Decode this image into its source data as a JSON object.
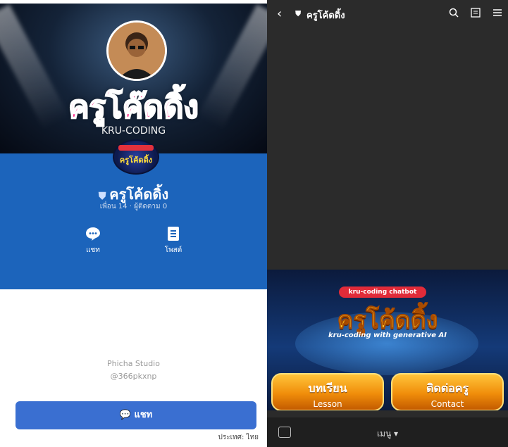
{
  "left": {
    "hero_title": "ครูโค๊ดดิ้ง",
    "hero_subtitle": "KRU-CODING",
    "logo_text": "ครูโค้ดดิ้ง",
    "account_name": "ครูโค้ดดิ้ง",
    "stats": "เพื่อน 14 · ผู้ติดตาม 0",
    "actions": [
      {
        "label": "แชท",
        "icon": "chat-icon"
      },
      {
        "label": "โพสต์",
        "icon": "post-icon"
      }
    ],
    "studio_name": "Phicha Studio",
    "studio_id": "@366pkxnp",
    "chat_button": "แชท",
    "language": "ประเทศ: ไทย"
  },
  "right": {
    "title": "ครูโค้ดดิ้ง",
    "banner": {
      "tag": "kru-coding chatbot",
      "title": "ครูโค้ดดิ้ง",
      "subtitle": "kru-coding with generative AI"
    },
    "buttons": [
      {
        "th": "บทเรียน",
        "en": "Lesson"
      },
      {
        "th": "ติดต่อครู",
        "en": "Contact"
      }
    ],
    "menu_label": "เมนู ▾"
  },
  "colors": {
    "blue": "#1c64bb",
    "button_blue": "#3a6fd1",
    "orange": "#f08d0a"
  }
}
